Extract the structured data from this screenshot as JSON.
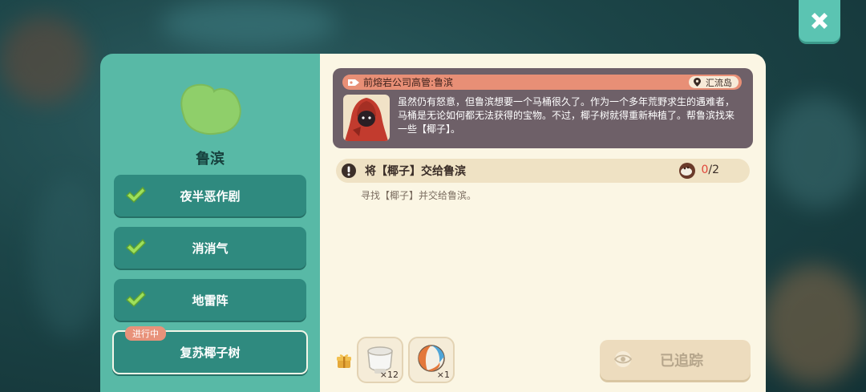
{
  "close_button": {
    "icon": "close-icon"
  },
  "left_panel": {
    "npc_name": "鲁滨",
    "npc_icon": "island-icon",
    "quests": [
      {
        "label": "夜半恶作剧",
        "status": "completed",
        "icon": "check-icon"
      },
      {
        "label": "消消气",
        "status": "completed",
        "icon": "check-icon"
      },
      {
        "label": "地雷阵",
        "status": "completed",
        "icon": "check-icon"
      },
      {
        "label": "复苏椰子树",
        "status": "in-progress",
        "badge": "进行中"
      }
    ]
  },
  "npc_card": {
    "title": "前熔岩公司高管:鲁滨",
    "location": "汇流岛",
    "description": "虽然仍有怒意，但鲁滨想要一个马桶很久了。作为一个多年荒野求生的遇难者，马桶是无论如何都无法获得的宝物。不过，椰子树就得重新种植了。帮鲁滨找来一些【椰子】。"
  },
  "objective": {
    "text": "将【椰子】交给鲁滨",
    "current": "0",
    "separator": "/",
    "total": "2",
    "subtext": "寻找【椰子】并交给鲁滨。"
  },
  "rewards": [
    {
      "icon": "toilet-icon",
      "quantity": "×12"
    },
    {
      "icon": "beach-ball-icon",
      "quantity": "×1"
    }
  ],
  "track_button": {
    "label": "已追踪",
    "icon": "eye-icon"
  },
  "colors": {
    "left_panel": "#58b9a6",
    "quest_button": "#2f8a7f",
    "right_panel": "#fbf6e4",
    "npc_card": "#6e6068",
    "accent": "#e88f76",
    "progress_current": "#e0453a"
  }
}
